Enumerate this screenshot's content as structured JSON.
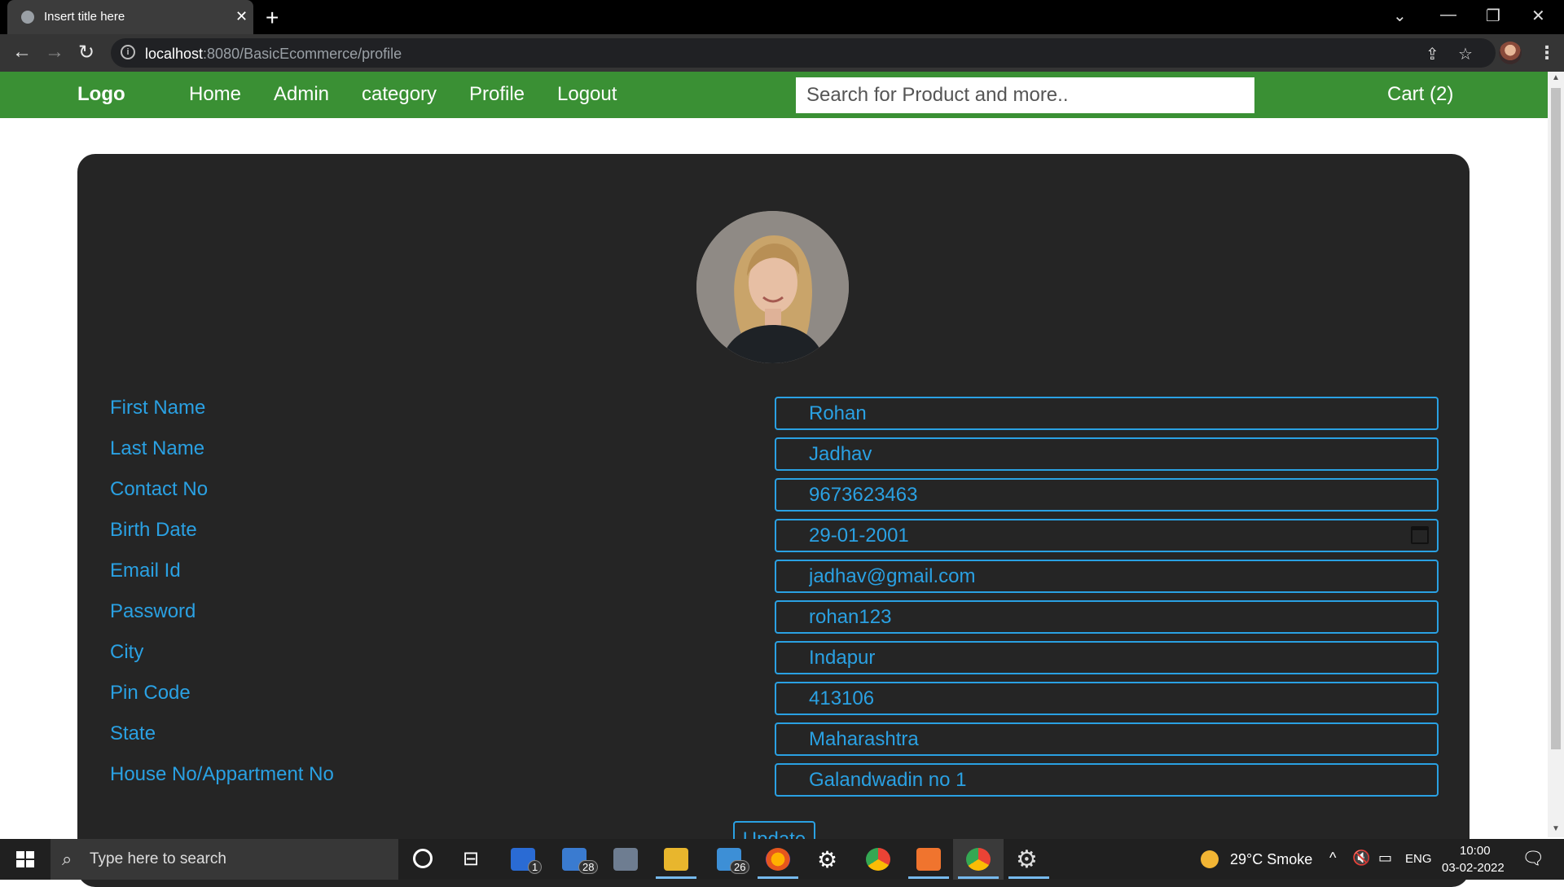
{
  "browser": {
    "tab_title": "Insert title here",
    "url_host": "localhost",
    "url_rest": ":8080/BasicEcommerce/profile"
  },
  "navbar": {
    "logo": "Logo",
    "links": [
      "Home",
      "Admin",
      "category",
      "Profile",
      "Logout"
    ],
    "search_placeholder": "Search for Product and more..",
    "cart": "Cart (2)"
  },
  "profile": {
    "fields": [
      {
        "label": "First Name",
        "value": "Rohan"
      },
      {
        "label": "Last Name",
        "value": "Jadhav"
      },
      {
        "label": "Contact No",
        "value": "9673623463"
      },
      {
        "label": "Birth Date",
        "value": "29-01-2001"
      },
      {
        "label": "Email Id",
        "value": "jadhav@gmail.com"
      },
      {
        "label": "Password",
        "value": "rohan123"
      },
      {
        "label": "City",
        "value": "Indapur"
      },
      {
        "label": "Pin Code",
        "value": "413106"
      },
      {
        "label": "State",
        "value": "Maharashtra"
      },
      {
        "label": "House No/Appartment No",
        "value": "Galandwadin no 1"
      }
    ],
    "update_label": "Update"
  },
  "taskbar": {
    "search_placeholder": "Type here to search",
    "badges": {
      "app1": "1",
      "mail": "28",
      "app2": "26"
    },
    "weather": "29°C  Smoke",
    "lang": "ENG",
    "time": "10:00",
    "date": "03-02-2022"
  },
  "colors": {
    "navbar": "#3a9034",
    "card": "#252525",
    "accent": "#2aa1e3"
  }
}
